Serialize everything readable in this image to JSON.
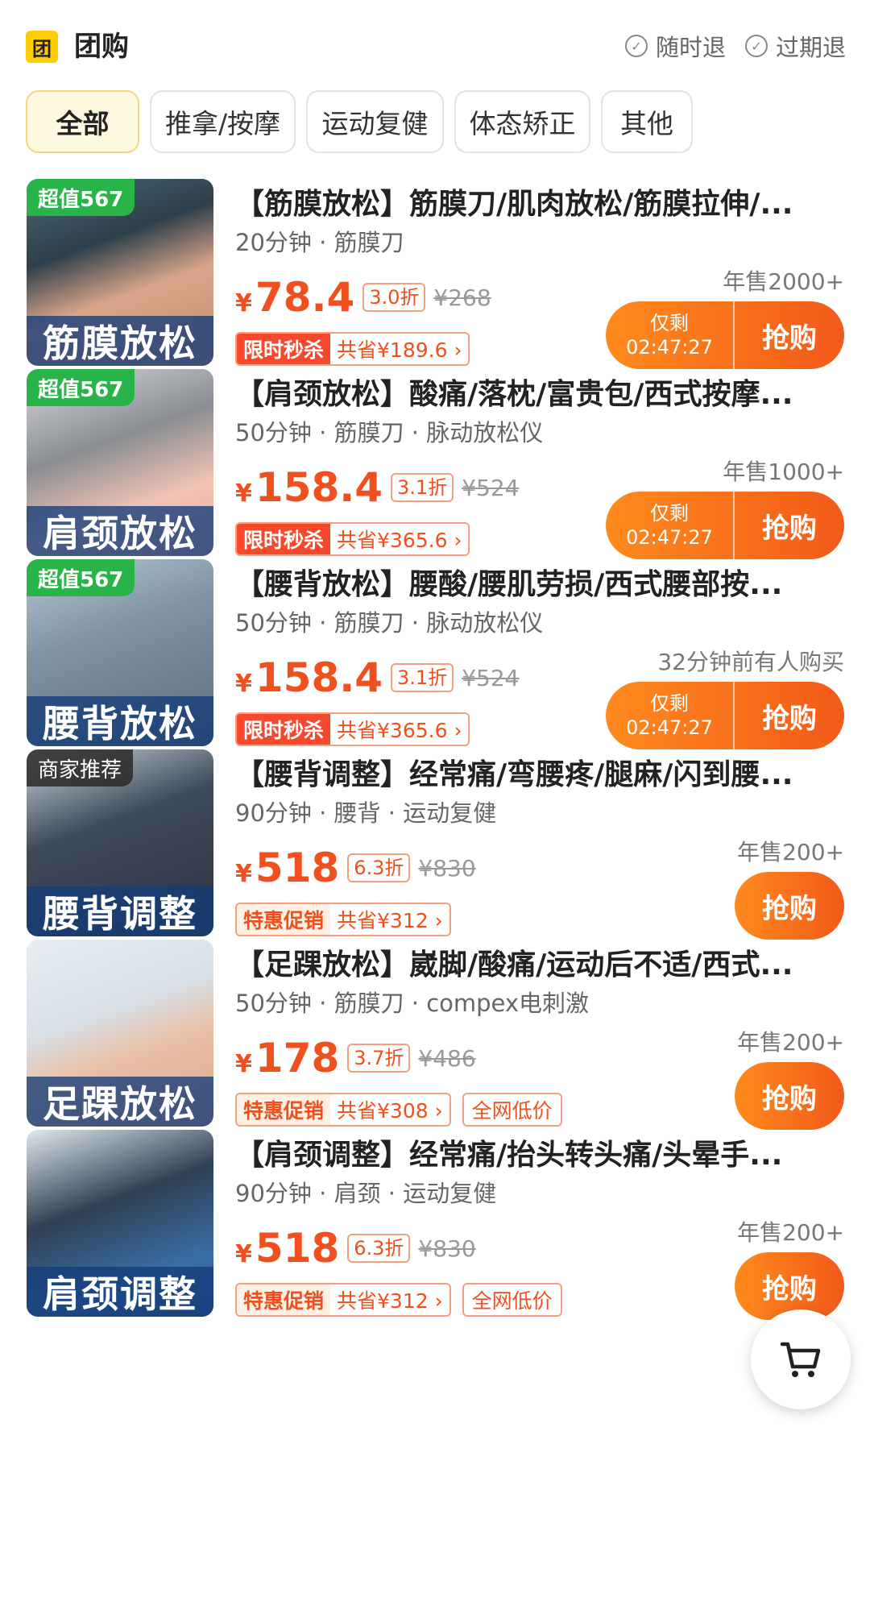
{
  "header": {
    "logo_char": "团",
    "title": "团购",
    "guarantees": [
      "随时退",
      "过期退"
    ]
  },
  "tabs": [
    "全部",
    "推拿/按摩",
    "运动复健",
    "体态矫正",
    "其他"
  ],
  "active_tab": 0,
  "products": [
    {
      "badge": "超值567",
      "badge_style": "green",
      "caption": "筋膜放松",
      "title": "【筋膜放松】筋膜刀/肌肉放松/筋膜拉伸/...",
      "meta": "20分钟 · 筋膜刀",
      "sales": "年售2000+",
      "yen": "¥",
      "price": "78.4",
      "discount": "3.0折",
      "original": "¥268",
      "promo_tag": "限时秒杀",
      "promo_style": "red",
      "save": "共省¥189.6 ›",
      "lowest": "",
      "countdown_label": "仅剩",
      "countdown": "02:47:27",
      "buy": "抢购"
    },
    {
      "badge": "超值567",
      "badge_style": "green",
      "caption": "肩颈放松",
      "title": "【肩颈放松】酸痛/落枕/富贵包/西式按摩...",
      "meta": "50分钟 · 筋膜刀 · 脉动放松仪",
      "sales": "年售1000+",
      "yen": "¥",
      "price": "158.4",
      "discount": "3.1折",
      "original": "¥524",
      "promo_tag": "限时秒杀",
      "promo_style": "red",
      "save": "共省¥365.6 ›",
      "lowest": "",
      "countdown_label": "仅剩",
      "countdown": "02:47:27",
      "buy": "抢购"
    },
    {
      "badge": "超值567",
      "badge_style": "green",
      "caption": "腰背放松",
      "title": "【腰背放松】腰酸/腰肌劳损/西式腰部按...",
      "meta": "50分钟 · 筋膜刀 · 脉动放松仪",
      "sales": "32分钟前有人购买",
      "yen": "¥",
      "price": "158.4",
      "discount": "3.1折",
      "original": "¥524",
      "promo_tag": "限时秒杀",
      "promo_style": "red",
      "save": "共省¥365.6 ›",
      "lowest": "",
      "countdown_label": "仅剩",
      "countdown": "02:47:27",
      "buy": "抢购"
    },
    {
      "badge": "商家推荐",
      "badge_style": "dark",
      "caption": "腰背调整",
      "title": "【腰背调整】经常痛/弯腰疼/腿麻/闪到腰...",
      "meta": "90分钟 · 腰背 · 运动复健",
      "sales": "年售200+",
      "yen": "¥",
      "price": "518",
      "discount": "6.3折",
      "original": "¥830",
      "promo_tag": "特惠促销",
      "promo_style": "orange",
      "save": "共省¥312 ›",
      "lowest": "",
      "countdown_label": "",
      "countdown": "",
      "buy": "抢购"
    },
    {
      "badge": "",
      "badge_style": "none",
      "caption": "足踝放松",
      "title": "【足踝放松】崴脚/酸痛/运动后不适/西式...",
      "meta": "50分钟 · 筋膜刀 · compex电刺激",
      "sales": "年售200+",
      "yen": "¥",
      "price": "178",
      "discount": "3.7折",
      "original": "¥486",
      "promo_tag": "特惠促销",
      "promo_style": "orange",
      "save": "共省¥308 ›",
      "lowest": "全网低价",
      "countdown_label": "",
      "countdown": "",
      "buy": "抢购"
    },
    {
      "badge": "",
      "badge_style": "none",
      "caption": "肩颈调整",
      "title": "【肩颈调整】经常痛/抬头转头痛/头晕手...",
      "meta": "90分钟 · 肩颈 · 运动复健",
      "sales": "年售200+",
      "yen": "¥",
      "price": "518",
      "discount": "6.3折",
      "original": "¥830",
      "promo_tag": "特惠促销",
      "promo_style": "orange",
      "save": "共省¥312 ›",
      "lowest": "全网低价",
      "countdown_label": "",
      "countdown": "",
      "buy": "抢购"
    }
  ],
  "colors": {
    "accent": "#f0501d",
    "button_start": "#ff8a1c",
    "button_end": "#f25a1a",
    "badge_green": "#29b44a",
    "tab_active_bg": "#fff8e1"
  }
}
